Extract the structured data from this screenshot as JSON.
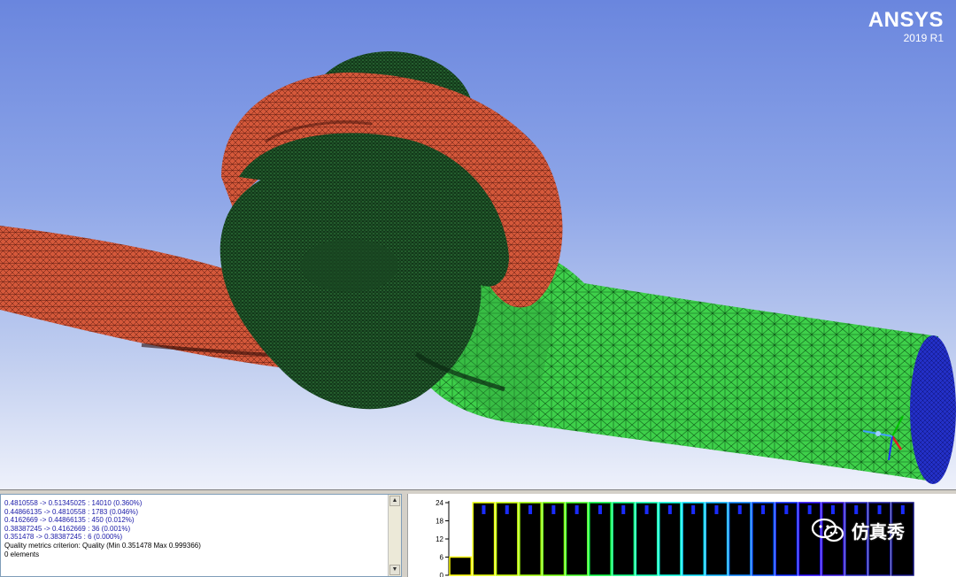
{
  "brand": {
    "name": "ANSYS",
    "version": "2019 R1"
  },
  "colors": {
    "mesh_red": "#d4583a",
    "mesh_dark_green": "#1e5a2a",
    "mesh_green": "#3ed04a",
    "outlet_blue": "#2330c8",
    "background_top": "#6a86de",
    "background_bottom": "#eef1fb"
  },
  "icons": [
    "axis-triad-icon",
    "wechat-icon",
    "scroll-up-icon",
    "scroll-down-icon"
  ],
  "log": {
    "lines": [
      {
        "range": "0.4810558 -> 0.51345025 : 14010 (0.360%)"
      },
      {
        "range": "0.44866135 -> 0.4810558 : 1783 (0.046%)"
      },
      {
        "range": "0.4162669 -> 0.44866135 : 450 (0.012%)"
      },
      {
        "range": "0.38387245 -> 0.4162669 : 36 (0.001%)"
      },
      {
        "range": "0.351478 -> 0.38387245 : 6 (0.000%)"
      }
    ],
    "criterion": "Quality metrics criterion: Quality (Min 0.351478 Max 0.999366)",
    "elements": "0 elements"
  },
  "chart_data": {
    "type": "bar",
    "yticks": [
      "24",
      "18",
      "12",
      "6",
      "0"
    ],
    "ylim": [
      0,
      24
    ],
    "bars": 20,
    "first_bar_value": 6,
    "values": [
      6,
      24,
      24,
      24,
      24,
      24,
      24,
      24,
      24,
      24,
      24,
      24,
      24,
      24,
      24,
      24,
      24,
      24,
      24,
      24
    ],
    "bar_fill": "#000000",
    "marker_color": "#1a2cff",
    "bar_edge_colors": [
      "#ffff00",
      "#e6ff00",
      "#c8ff00",
      "#a0ff00",
      "#70ff00",
      "#40ff20",
      "#00ff40",
      "#00ff80",
      "#00ffb0",
      "#00ffe0",
      "#00e0ff",
      "#00b0ff",
      "#0080ff",
      "#0050ff",
      "#0020ff",
      "#2000ff",
      "#3010e0",
      "#2020c0",
      "#1a1aa0",
      "#101080"
    ]
  },
  "watermark": {
    "text": "仿真秀"
  }
}
